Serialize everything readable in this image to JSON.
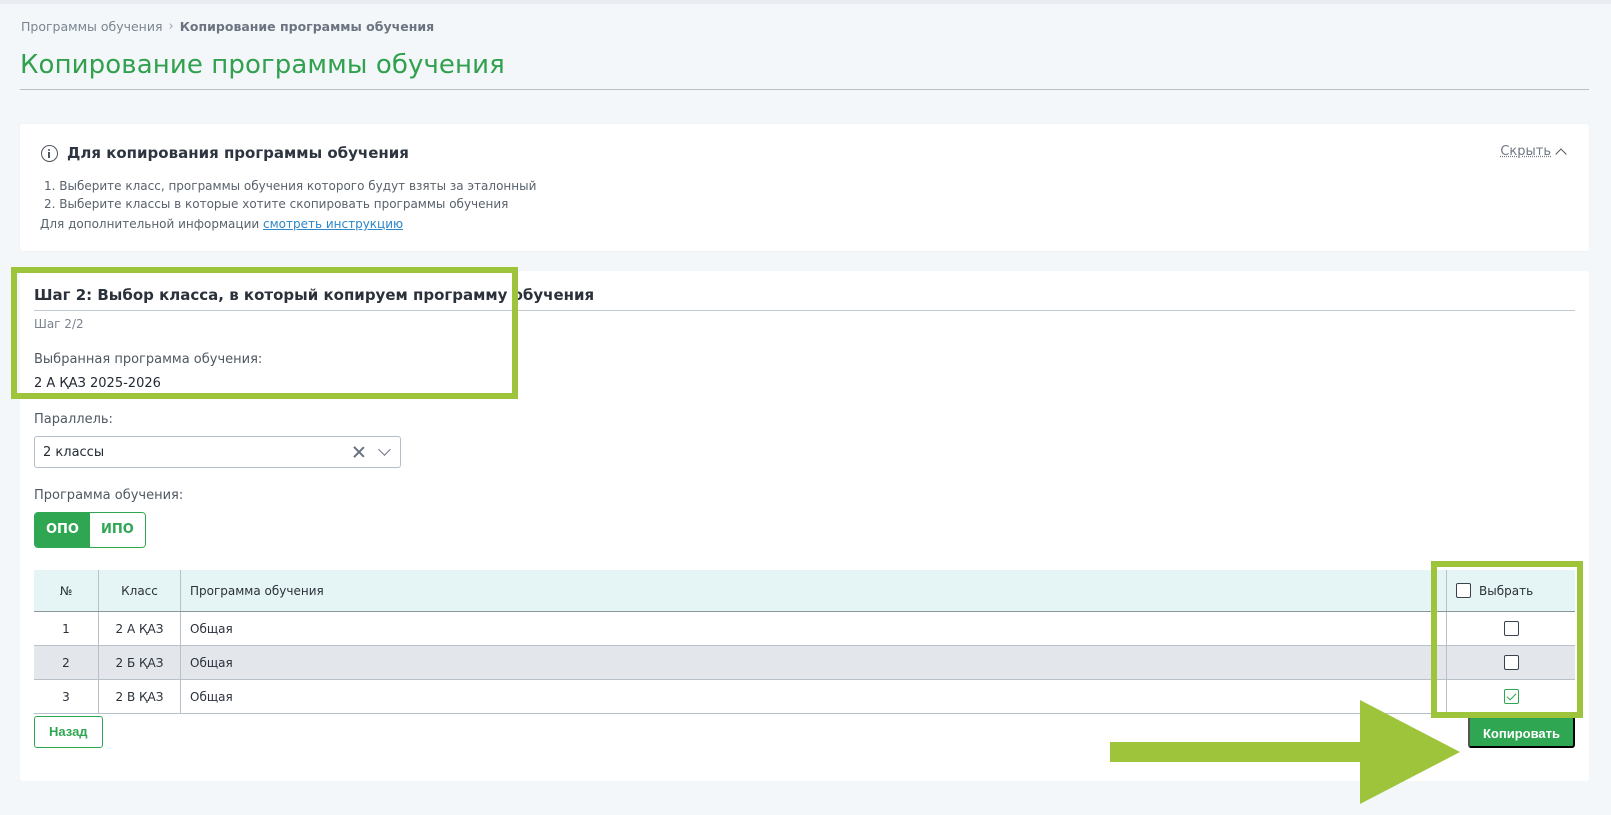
{
  "breadcrumb": {
    "parent": "Программы обучения",
    "separator": "›",
    "current": "Копирование программы обучения"
  },
  "page_title": "Копирование программы обучения",
  "info": {
    "title": "Для копирования программы обучения",
    "hide_label": "Скрыть",
    "steps": [
      "1. Выберите класс, программы обучения которого будут взяты за эталонный",
      "2. Выберите классы в которые хотите скопировать программы обучения"
    ],
    "extra_text": "Для дополнительной информации",
    "extra_link": "смотреть инструкцию"
  },
  "step": {
    "title": "Шаг 2: Выбор класса, в который копируем программу обучения",
    "subtitle": "Шаг 2/2",
    "selected_label": "Выбранная программа обучения:",
    "selected_value": "2 А ҚАЗ 2025-2026",
    "parallel_label": "Параллель:",
    "parallel_value": "2 классы",
    "program_label": "Программа обучения:",
    "program_options": [
      "ОПО",
      "ИПО"
    ],
    "program_selected": "ОПО"
  },
  "table": {
    "headers": {
      "num": "№",
      "class": "Класс",
      "program": "Программа обучения",
      "select": "Выбрать"
    },
    "rows": [
      {
        "num": "1",
        "class": "2 А ҚАЗ",
        "program": "Общая",
        "checked": false
      },
      {
        "num": "2",
        "class": "2 Б ҚАЗ",
        "program": "Общая",
        "checked": false
      },
      {
        "num": "3",
        "class": "2 В ҚАЗ",
        "program": "Общая",
        "checked": true
      }
    ]
  },
  "buttons": {
    "back": "Назад",
    "copy": "Копировать"
  },
  "colors": {
    "accent": "#2fa652",
    "highlight": "#9ec43b",
    "title": "#31a14f"
  }
}
